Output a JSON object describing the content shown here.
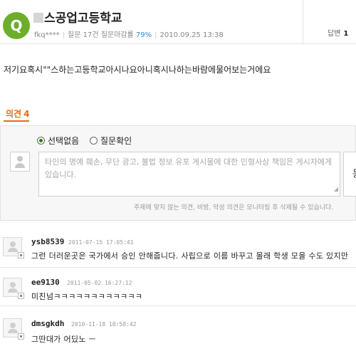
{
  "header": {
    "badge": "Q",
    "title": "스공업고등학교",
    "author": "fkq****",
    "stats": "질문 17건 질문마감률",
    "close_rate": "79%",
    "date": "2010.09.25 13:38",
    "answers_label": "답변",
    "answers_count": "1"
  },
  "question": {
    "text": "저기요혹시\"\"스하는고등학교아시나요아니혹시나하는바람에물어보는거에요"
  },
  "opinions": {
    "tab_label": "의견",
    "count": "4"
  },
  "form": {
    "radio_none": "선택없음",
    "radio_confirm": "질문확인",
    "placeholder": "타인의 명예 훼손, 무단 광고, 불법 정보 유포 게시물에 대한 민형사상 책임은 게시자에게 있습니다.",
    "submit_label": "등",
    "notice": "주제에 맞지 않는 의견, 비방, 악성 의견은 모니터링 후 삭제될 수 있습니다."
  },
  "comments": [
    {
      "user": "ysb8539",
      "date": "2011-07-15 17:05:41",
      "text": "그런 더러운곳은 국가에서 승인 안해줍니다. 사립으로 이름 바꾸고 몰래 학생 모을 수도 있지만"
    },
    {
      "user": "ee9130",
      "date": "2011-05-02 16:27:12",
      "text": "미친넘ㅋㅋㅋㅋㅋㅋㅋㅋㅋㅋㅋㅋ"
    },
    {
      "user": "dmsgkdh",
      "date": "2010-11-18 10:58:42",
      "text": "그딴대가 어딨노 ㅡ"
    }
  ]
}
